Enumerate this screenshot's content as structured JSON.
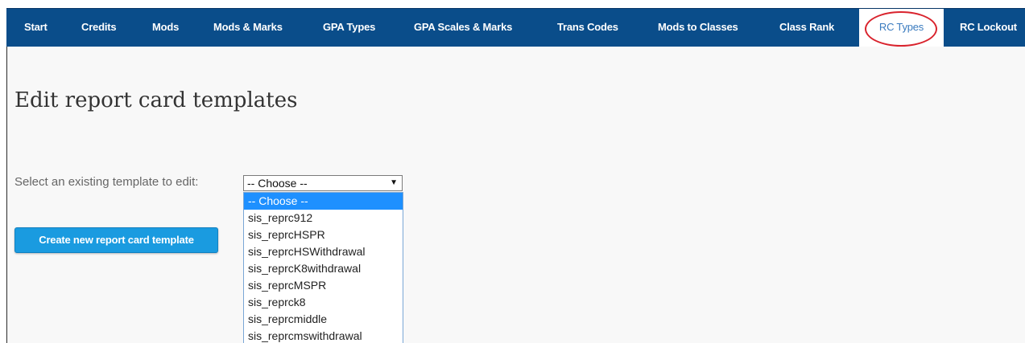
{
  "nav": {
    "tabs": [
      {
        "label": "Start"
      },
      {
        "label": "Credits"
      },
      {
        "label": "Mods"
      },
      {
        "label": "Mods & Marks"
      },
      {
        "label": "GPA Types"
      },
      {
        "label": "GPA Scales & Marks"
      },
      {
        "label": "Trans Codes"
      },
      {
        "label": "Mods to Classes"
      },
      {
        "label": "Class Rank"
      },
      {
        "label": "RC Types",
        "active": true
      },
      {
        "label": "RC Lockout"
      }
    ],
    "highlight_color": "#d9232d"
  },
  "page": {
    "title": "Edit report card templates"
  },
  "template_select": {
    "label": "Select an existing template to edit:",
    "value": "-- Choose --",
    "options": [
      "-- Choose --",
      "sis_reprc912",
      "sis_reprcHSPR",
      "sis_reprcHSWithdrawal",
      "sis_reprcK8withdrawal",
      "sis_reprcMSPR",
      "sis_reprck8",
      "sis_reprcmiddle",
      "sis_reprcmswithdrawal"
    ]
  },
  "create_button": {
    "label": "Create new report card template"
  },
  "colors": {
    "nav_bg": "#0a4d8a",
    "accent": "#1a9be0",
    "selected_option": "#1e90ff"
  }
}
